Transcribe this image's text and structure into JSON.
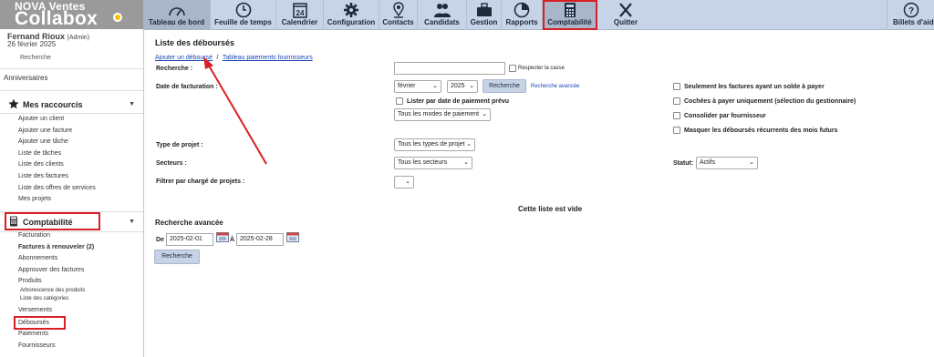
{
  "app": {
    "brand_top": "NOVA Ventes",
    "brand_main": "Collabox"
  },
  "topnav": {
    "items": [
      {
        "label": "Tableau de bord",
        "icon": "dashboard-gauge-icon"
      },
      {
        "label": "Feuille de temps",
        "icon": "clock-icon"
      },
      {
        "label": "Calendrier",
        "icon": "calendar-icon",
        "icon_text": "24"
      },
      {
        "label": "Configuration",
        "icon": "gear-icon"
      },
      {
        "label": "Contacts",
        "icon": "contact-pin-icon"
      },
      {
        "label": "Candidats",
        "icon": "users-icon"
      },
      {
        "label": "Gestion",
        "icon": "briefcase-icon"
      },
      {
        "label": "Rapports",
        "icon": "pie-chart-icon"
      },
      {
        "label": "Comptabilité",
        "icon": "calculator-icon"
      },
      {
        "label": "Quitter",
        "icon": "close-x-icon"
      },
      {
        "label": "Billets d'aid",
        "icon": "help-question-icon"
      }
    ]
  },
  "sidebar": {
    "user_name": "Fernand Rioux",
    "user_role": "(Admin)",
    "user_date": "26 février 2025",
    "search": "Recherche",
    "anniversaires": "Anniversaires",
    "shortcuts_title": "Mes raccourcis",
    "shortcuts": [
      "Ajouter un client",
      "Ajouter une facture",
      "Ajouter une tâche",
      "Liste de tâches",
      "Liste des clients",
      "Liste des factures",
      "Liste des offres de services",
      "Mes projets"
    ],
    "accounting_title": "Comptabilité",
    "accounting": [
      {
        "label": "Facturation",
        "style": "normal"
      },
      {
        "label": "Factures à renouveler (2)",
        "style": "bold"
      },
      {
        "label": "Abonnements",
        "style": "normal"
      },
      {
        "label": "Approuver des factures",
        "style": "normal"
      },
      {
        "label": "Produits",
        "style": "normal"
      },
      {
        "label": "Arborescence des produits",
        "style": "sub"
      },
      {
        "label": "Liste des catégories",
        "style": "sub"
      },
      {
        "label": "Versements",
        "style": "normal"
      },
      {
        "label": "Déboursés",
        "style": "normal"
      },
      {
        "label": "Paiements",
        "style": "normal"
      },
      {
        "label": "Fournisseurs",
        "style": "normal"
      }
    ]
  },
  "main": {
    "title": "Liste des déboursés",
    "link_add": "Ajouter un déboursé",
    "link_sep": "/",
    "link_table": "Tableau paiements fournisseurs",
    "search_label": "Recherche :",
    "search_value": "",
    "respect_case": "Respecter la casse",
    "date_label": "Date de facturation :",
    "month_value": "février",
    "year_value": "2025",
    "search_button": "Recherche",
    "advanced_link": "Recherche avancée",
    "list_by_date": "Lister par date de paiement prévu",
    "payment_modes": "Tous les modes de paiement",
    "project_type_label": "Type de projet :",
    "project_type_value": "Tous les types de projet",
    "sectors_label": "Secteurs :",
    "sectors_value": "Tous les secteurs",
    "filter_label": "Filtrer par chargé de projets :",
    "filter_value": "",
    "options": [
      "Seulement les factures ayant un solde à payer",
      "Cochées à payer uniquement (sélection du gestionnaire)",
      "Consolider par fournisseur",
      "Masquer les déboursés récurrents des mois futurs"
    ],
    "status_label": "Statut:",
    "status_value": "Actifs",
    "empty_message": "Cette liste est vide",
    "advanced_title": "Recherche avancée",
    "from_label": "De",
    "from_value": "2025-02-01",
    "to_label": "À",
    "to_value": "2025-02-28",
    "advanced_button": "Recherche"
  },
  "colors": {
    "nav_bg": "#c7d3e6",
    "highlight_red": "#d81f26",
    "link_blue": "#1a46b4",
    "logo_bg": "#9a9a9a"
  }
}
